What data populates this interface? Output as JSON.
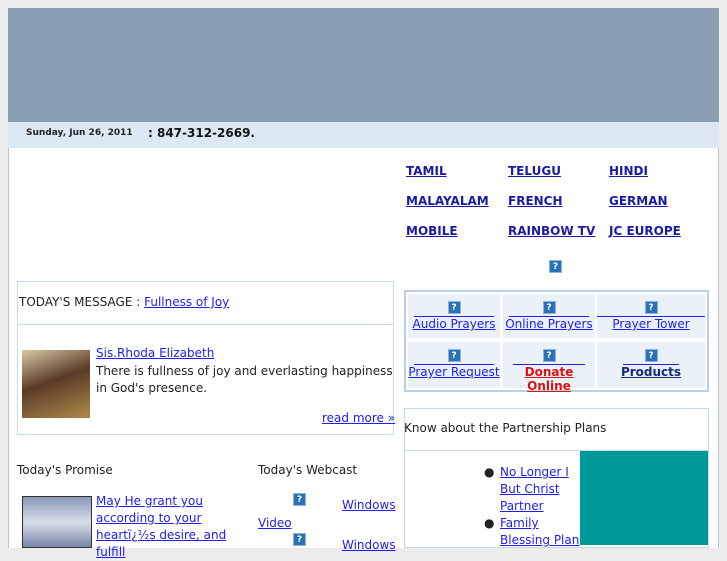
{
  "header": {
    "date": "Sunday, Jun 26, 2011",
    "phone": ": 847-312-2669."
  },
  "languages": [
    "TAMIL",
    "TELUGU",
    "HINDI",
    "MALAYALAM",
    "FRENCH",
    "GERMAN",
    "MOBILE",
    "RAINBOW TV",
    "JC EUROPE"
  ],
  "message": {
    "label": "TODAY'S MESSAGE : ",
    "title": "Fullness of Joy",
    "author": "Sis.Rhoda Elizabeth",
    "text": "There is fullness of joy and everlasting happiness in God's presence.",
    "read_more": "read more »"
  },
  "quick_links": [
    {
      "label": "Audio Prayers"
    },
    {
      "label": "Online Prayers"
    },
    {
      "label": "Prayer Tower"
    },
    {
      "label": "Prayer Request"
    },
    {
      "label": "Donate Online",
      "color": "#dd1111"
    },
    {
      "label": "Products",
      "color": "#1a2a7a"
    }
  ],
  "partnership": {
    "title": "Know about the Partnership Plans",
    "items": [
      "No Longer I But Christ Partner",
      "Family Blessing Plan"
    ],
    "accent": "#009999"
  },
  "promise": {
    "title": "Today's Promise",
    "text": "May He grant you according to your heartï¿½s desire, and fulfill"
  },
  "webcast": {
    "title": "Today's Webcast",
    "video": "Video",
    "windows1": "Windows",
    "windows2": "Windows"
  },
  "icon_glyph": "?"
}
